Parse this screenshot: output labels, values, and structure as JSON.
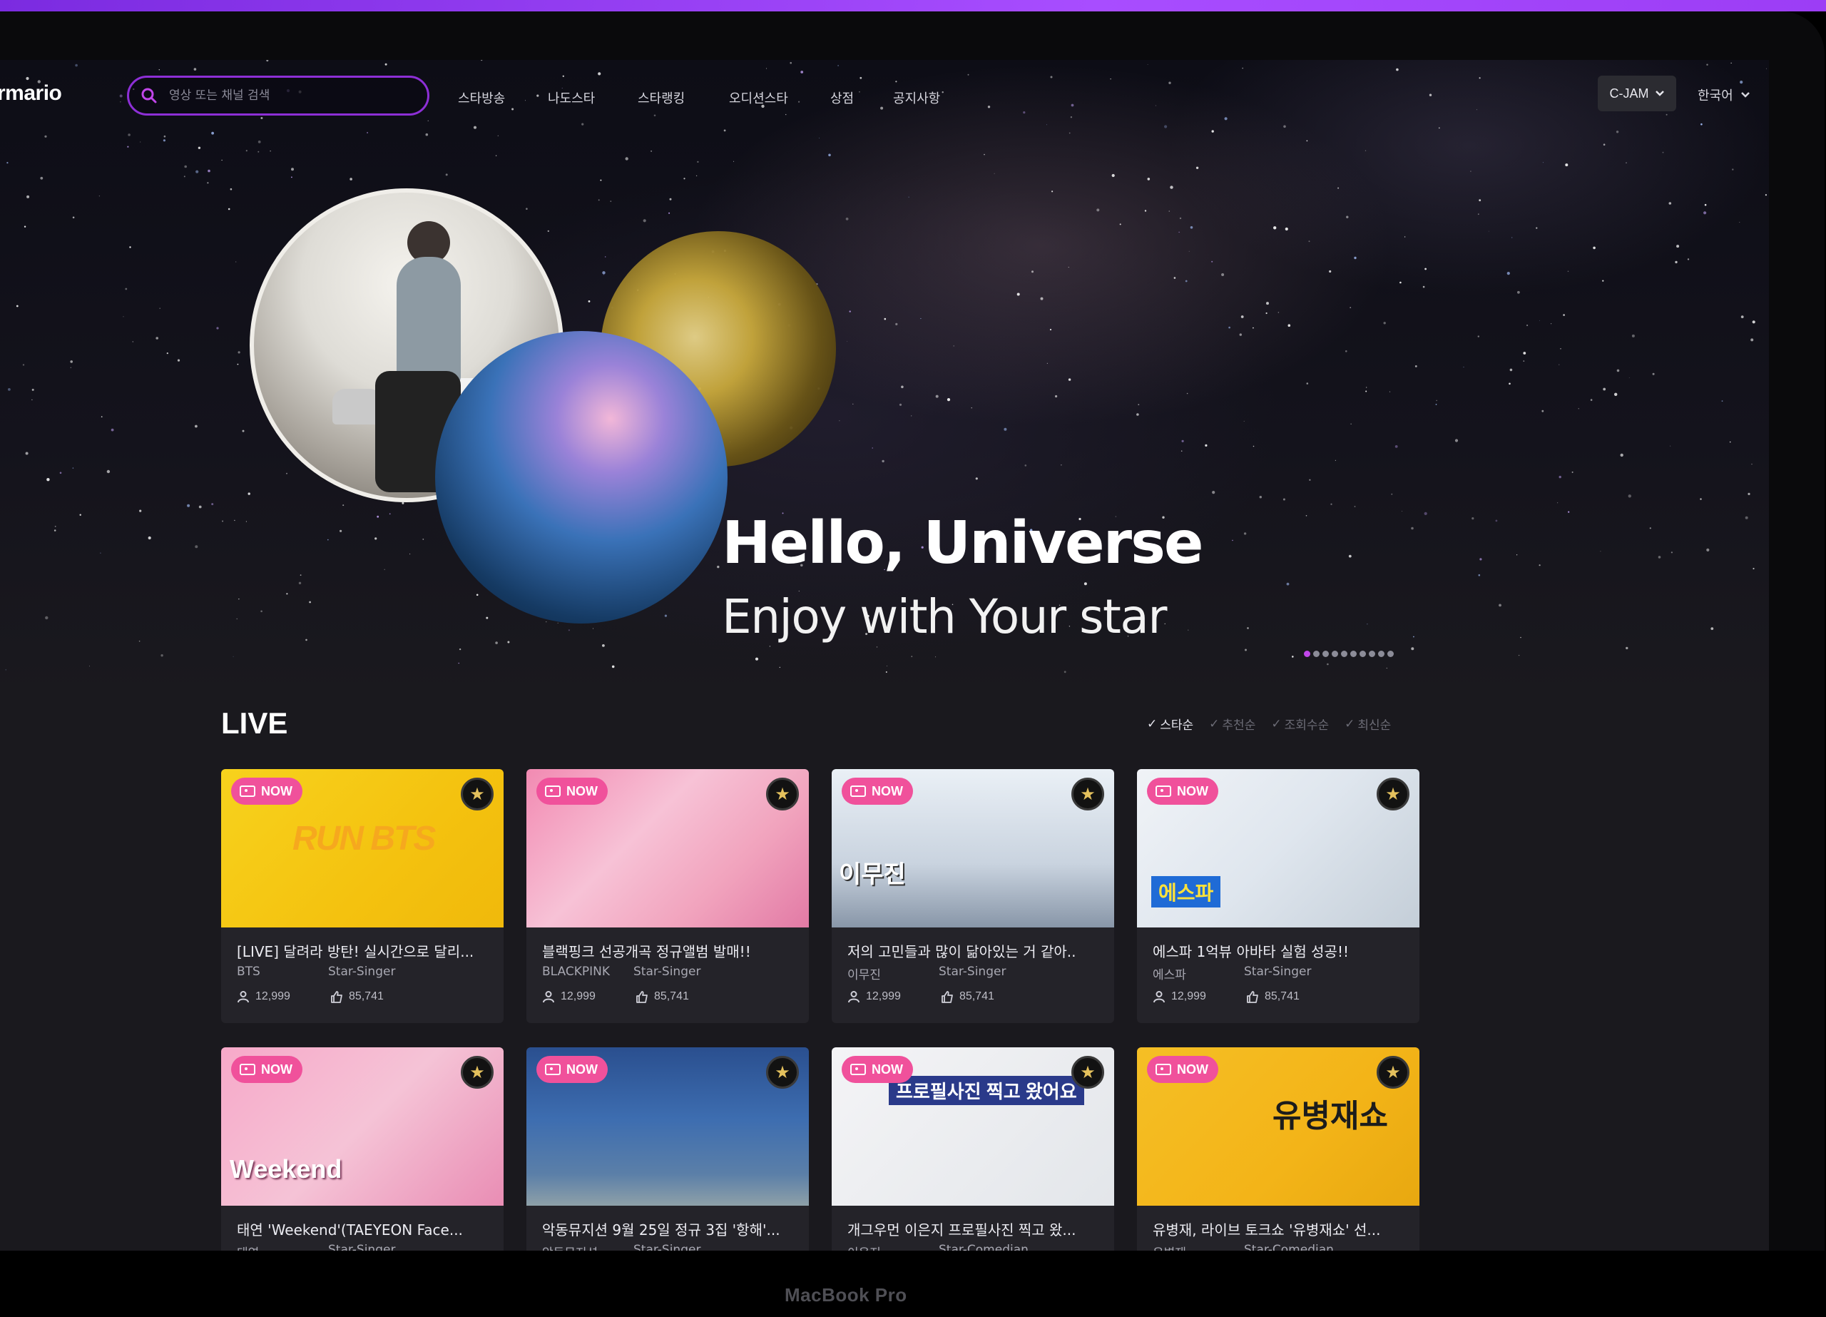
{
  "header": {
    "logo": "rmario",
    "search_placeholder": "영상 또는 채널 검색",
    "nav": [
      "스타방송",
      "나도스타",
      "스타랭킹",
      "오디션스타",
      "상점",
      "공지사항"
    ],
    "account_label": "C-JAM",
    "language_label": "한국어"
  },
  "hero": {
    "title": "Hello, Universe",
    "subtitle": "Enjoy with Your star",
    "slide_count": 10,
    "active_slide": 1
  },
  "live": {
    "title": "LIVE",
    "sort_options": [
      "스타순",
      "추천순",
      "조회수순",
      "최신순"
    ],
    "now_label": "NOW",
    "cards": [
      {
        "title": "[LIVE] 달려라 방탄! 실시간으로 달리...",
        "artist": "BTS",
        "category": "Star-Singer",
        "viewers": "12,999",
        "likes": "85,741",
        "thumb_text": "RUN BTS"
      },
      {
        "title": "블랙핑크 선공개곡 정규앨범 발매!!",
        "artist": "BLACKPINK",
        "category": "Star-Singer",
        "viewers": "12,999",
        "likes": "85,741",
        "thumb_text": ""
      },
      {
        "title": "저의 고민들과 많이 닮아있는 거 같아..",
        "artist": "이무진",
        "category": "Star-Singer",
        "viewers": "12,999",
        "likes": "85,741",
        "thumb_text": "이무진"
      },
      {
        "title": "에스파 1억뷰 아바타 실험 성공!!",
        "artist": "에스파",
        "category": "Star-Singer",
        "viewers": "12,999",
        "likes": "85,741",
        "thumb_text": "에스파"
      },
      {
        "title": "태연 'Weekend'(TAEYEON Face...",
        "artist": "태연",
        "category": "Star-Singer",
        "thumb_text": "Weekend"
      },
      {
        "title": "악동뮤지션 9월 25일 정규 3집 '항해'...",
        "artist": "악동뮤지션",
        "category": "Star-Singer",
        "thumb_text": ""
      },
      {
        "title": "개그우먼 이은지 프로필사진 찍고 왔...",
        "artist": "이은지",
        "category": "Star-Comedian",
        "thumb_text": "프로필사진 찍고 왔어요"
      },
      {
        "title": "유병재, 라이브 토크쇼 '유병재쇼' 선...",
        "artist": "유병재",
        "category": "Star-Comedian",
        "thumb_text": "유병재쇼"
      }
    ]
  },
  "device_label": "MacBook Pro",
  "colors": {
    "accent": "#8d2fd6",
    "now_badge": "#f0519b",
    "top_bar": "#a84dff"
  }
}
